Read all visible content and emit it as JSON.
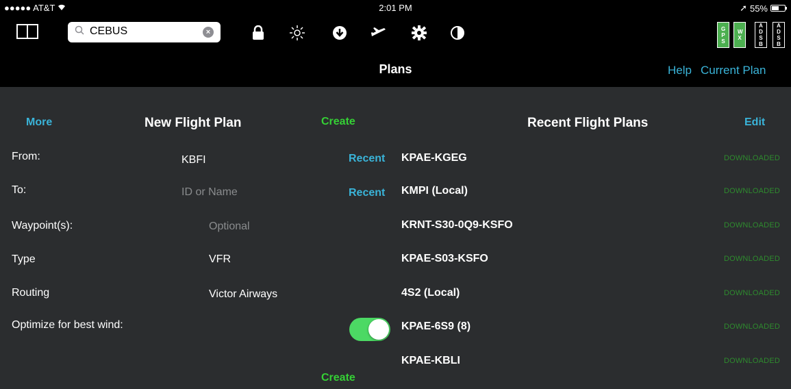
{
  "status_bar": {
    "carrier": "●●●●● AT&T",
    "time": "2:01 PM",
    "battery": "55%"
  },
  "toolbar": {
    "search_value": "CEBUS",
    "status_boxes": [
      {
        "label": "G P S",
        "green": true
      },
      {
        "label": "W X",
        "green": true
      },
      {
        "label": "A D S B",
        "green": false
      },
      {
        "label": "A D S B",
        "green": false
      }
    ]
  },
  "navbar": {
    "title": "Plans",
    "help": "Help",
    "current_plan": "Current Plan"
  },
  "new_plan": {
    "more": "More",
    "title": "New Flight Plan",
    "create_top": "Create",
    "create_bottom": "Create",
    "from_label": "From:",
    "from_value": "KBFI",
    "to_label": "To:",
    "to_placeholder": "ID or Name",
    "recent": "Recent",
    "waypoints_label": "Waypoint(s):",
    "waypoints_placeholder": "Optional",
    "type_label": "Type",
    "type_value": "VFR",
    "routing_label": "Routing",
    "routing_value": "Victor Airways",
    "optimize_label": "Optimize for best wind:",
    "optimize_on": true
  },
  "recent_plans": {
    "title": "Recent Flight Plans",
    "edit": "Edit",
    "items": [
      {
        "name": "KPAE-KGEG",
        "status": "DOWNLOADED"
      },
      {
        "name": "KMPI (Local)",
        "status": "DOWNLOADED"
      },
      {
        "name": "KRNT-S30-0Q9-KSFO",
        "status": "DOWNLOADED"
      },
      {
        "name": "KPAE-S03-KSFO",
        "status": "DOWNLOADED"
      },
      {
        "name": "4S2 (Local)",
        "status": "DOWNLOADED"
      },
      {
        "name": "KPAE-6S9 (8)",
        "status": "DOWNLOADED"
      },
      {
        "name": "KPAE-KBLI",
        "status": "DOWNLOADED"
      }
    ]
  }
}
